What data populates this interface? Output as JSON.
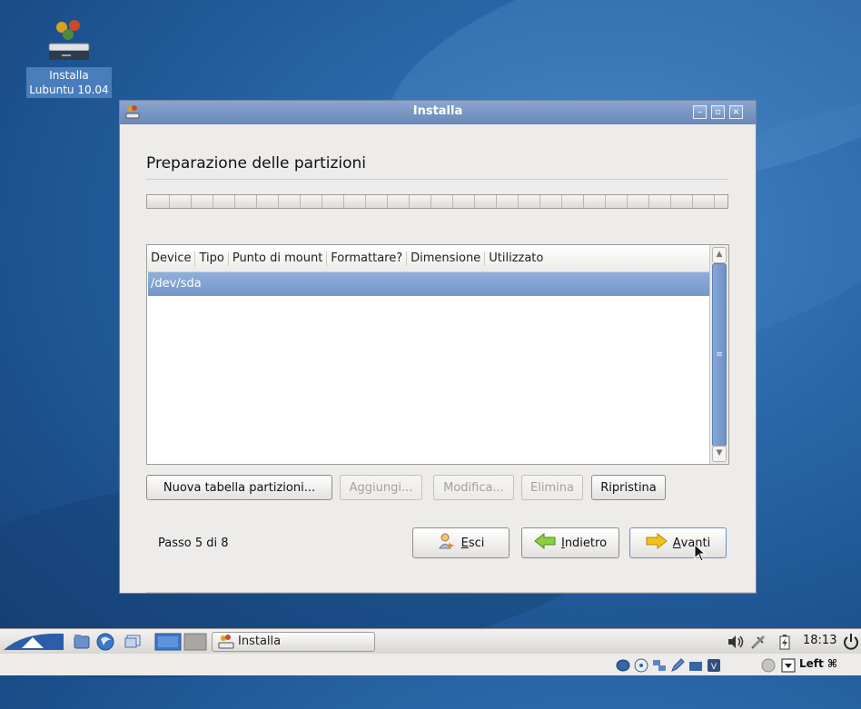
{
  "desktop": {
    "icon_label": "Installa\nLubuntu 10.04"
  },
  "window": {
    "title": "Installa",
    "controls": {
      "minimize": "–",
      "maximize": "▫",
      "close": "×"
    },
    "heading": "Preparazione delle partizioni",
    "table": {
      "columns": [
        "Device",
        "Tipo",
        "Punto di mount",
        "Formattare?",
        "Dimensione",
        "Utilizzato"
      ],
      "rows": [
        {
          "device": "/dev/sda",
          "selected": true
        }
      ]
    },
    "actions": {
      "new_table": "Nuova tabella partizioni...",
      "add": "Aggiungi...",
      "modify": "Modifica...",
      "delete": "Elimina",
      "restore": "Ripristina"
    },
    "step_text": "Passo 5 di 8",
    "nav": {
      "quit_acc": "E",
      "quit_rest": "sci",
      "back_acc": "I",
      "back_rest": "ndietro",
      "next_acc": "A",
      "next_rest": "vanti"
    }
  },
  "taskbar": {
    "task_label": "Installa",
    "clock": "18:13",
    "keyboard_layout": "Left ⌘"
  },
  "colors": {
    "desktop_blue": "#2a67a8",
    "titlebar": "#7896c4",
    "selection": "#7f9fd0"
  }
}
